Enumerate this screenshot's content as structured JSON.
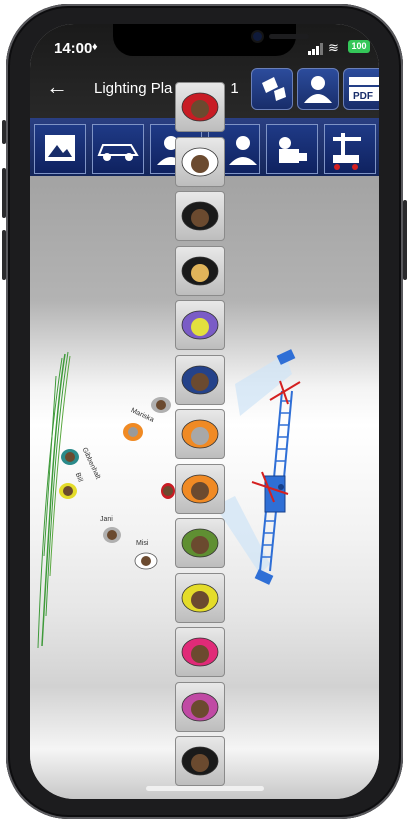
{
  "status": {
    "time": "14:00",
    "battery": "100"
  },
  "header": {
    "title": "Lighting Pla",
    "title_suffix": "1"
  },
  "toolbar_icons": [
    "image-icon",
    "car-icon",
    "actor-icon",
    "person-icon",
    "camera-icon",
    "crane-icon"
  ],
  "header_icons": [
    "lamps-icon",
    "person-icon",
    "pdf-icon"
  ],
  "scene_labels": {
    "mariska": "Mariska",
    "jani": "Jani",
    "misi": "Misi",
    "greenhouse": "Gibbenhalt",
    "bill": "Bill"
  },
  "colors": {
    "nav_blue": "#1f3a86",
    "accent_blue": "#2f6fd6"
  },
  "palette_hats": [
    "#c81c24",
    "#ffffff",
    "#1a1a1a",
    "#1a1a1a",
    "#7a5cc6",
    "#24428a",
    "#f08a24",
    "#f08a24",
    "#5f8f32",
    "#e4dc2a",
    "#e02a78",
    "#c04aa4",
    "#1a1a1a"
  ],
  "palette_faces": [
    "#6b4a2f",
    "#6b4a2f",
    "#6b4a2f",
    "#e0b45a",
    "#e3e03e",
    "#6b4a2f",
    "#a8a8a8",
    "#6b4a2f",
    "#6b4a2f",
    "#6b4a2f",
    "#6b4a2f",
    "#6b4a2f",
    "#6b4a2f"
  ]
}
